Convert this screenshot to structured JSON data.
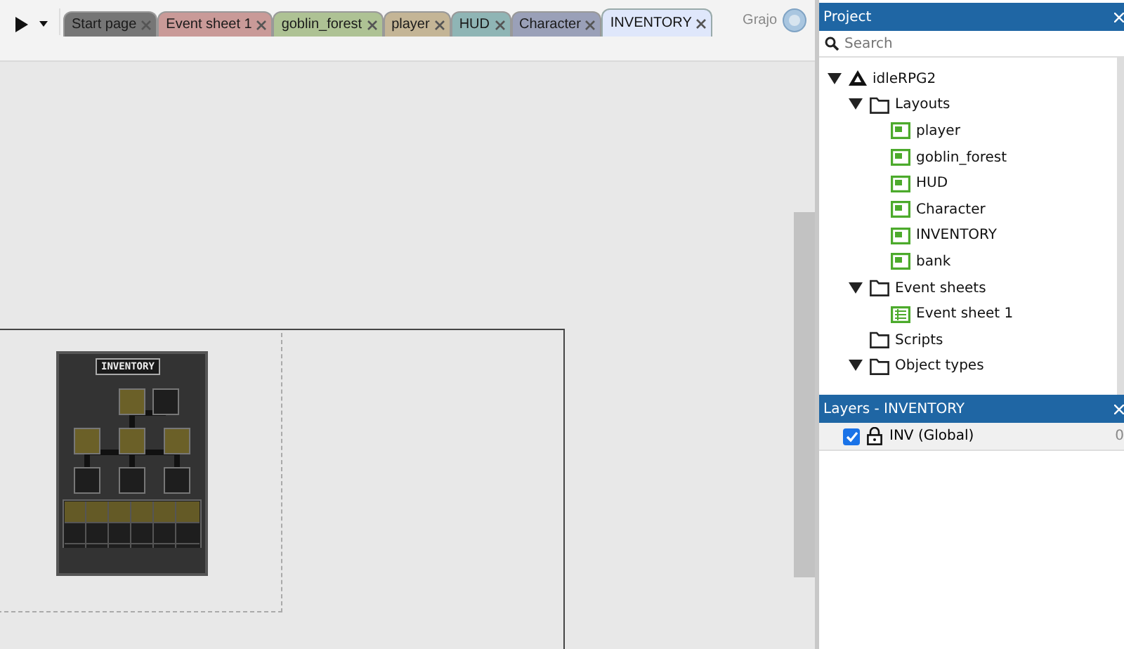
{
  "toolbar": {
    "user": "Grajo"
  },
  "tabs": [
    {
      "label": "Start page",
      "color": "#767676",
      "selected": false
    },
    {
      "label": "Event sheet 1",
      "color": "#c99a98",
      "selected": false
    },
    {
      "label": "goblin_forest",
      "color": "#aec294",
      "selected": false
    },
    {
      "label": "player",
      "color": "#c4b596",
      "selected": false
    },
    {
      "label": "HUD",
      "color": "#8fb5b5",
      "selected": false
    },
    {
      "label": "Character",
      "color": "#9aa0b8",
      "selected": false
    },
    {
      "label": "INVENTORY",
      "color": "#dfe7fb",
      "selected": true
    }
  ],
  "layout_view": {
    "sprite_title": "INVENTORY"
  },
  "project": {
    "title": "Project",
    "search": {
      "placeholder": "Search"
    },
    "tree": [
      {
        "label": "idleRPG2",
        "kind": "project",
        "expanded": true,
        "children": [
          {
            "label": "Layouts",
            "kind": "folder",
            "expanded": true,
            "children": [
              {
                "label": "player",
                "kind": "layout"
              },
              {
                "label": "goblin_forest",
                "kind": "layout"
              },
              {
                "label": "HUD",
                "kind": "layout"
              },
              {
                "label": "Character",
                "kind": "layout"
              },
              {
                "label": "INVENTORY",
                "kind": "layout"
              },
              {
                "label": "bank",
                "kind": "layout"
              }
            ]
          },
          {
            "label": "Event sheets",
            "kind": "folder",
            "expanded": true,
            "children": [
              {
                "label": "Event sheet 1",
                "kind": "eventsheet"
              }
            ]
          },
          {
            "label": "Scripts",
            "kind": "folder",
            "expanded": false
          },
          {
            "label": "Object types",
            "kind": "folder",
            "expanded": true
          }
        ]
      }
    ]
  },
  "layers": {
    "title": "Layers - INVENTORY",
    "items": [
      {
        "name": "INV (Global)",
        "checked": true,
        "count": "0"
      }
    ]
  }
}
